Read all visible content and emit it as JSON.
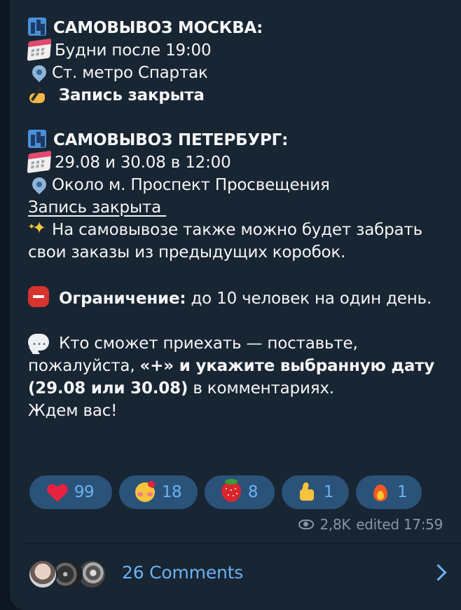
{
  "message": {
    "msk_title": "САМОВЫВОЗ МОСКВА:",
    "msk_days": "Будни после 19:00",
    "msk_place": "Ст. метро Спартак",
    "msk_status": "Запись закрыта",
    "spb_title": "САМОВЫВОЗ ПЕТЕРБУРГ:",
    "spb_dates": "29.08 и 30.08 в 12:00",
    "spb_place": "Около м. Проспект Просвещения",
    "spb_status": "Запись закрыта",
    "note": "На самовывозе также можно будет забрать свои заказы из предыдущих коробок.",
    "limit_label": "Ограничение:",
    "limit_text": " до 10 человек на один день.",
    "cta_part1": "Кто сможет приехать — поставьте, пожалуйста, ",
    "cta_bold": "«+» и укажите выбранную дату (29.08 или 30.08)",
    "cta_part2": " в комментариях.",
    "cta_end": "Ждем вас!"
  },
  "icons": {
    "city": "cityscape-icon",
    "calendar": "calendar-icon",
    "pin": "round-pushpin-icon",
    "hand": "writing-hand-icon",
    "sparkles": "sparkles-icon",
    "stop": "stop-sign-icon",
    "speech": "speech-balloon-icon"
  },
  "reactions": [
    {
      "icon": "red-heart-icon",
      "count": "99"
    },
    {
      "icon": "smiling-face-with-hearts-icon",
      "count": "18"
    },
    {
      "icon": "strawberry-icon",
      "count": "8"
    },
    {
      "icon": "thumbs-up-icon",
      "count": "1"
    },
    {
      "icon": "fire-icon",
      "count": "1"
    }
  ],
  "meta": {
    "views": "2,8K",
    "edited": "edited 17:59"
  },
  "comments": {
    "label": "26 Comments"
  },
  "colors": {
    "background": "#0e1621",
    "bubble": "#182533",
    "accent": "#6ab3f3",
    "reaction_pill": "#2b5278",
    "muted": "#8597a6"
  }
}
